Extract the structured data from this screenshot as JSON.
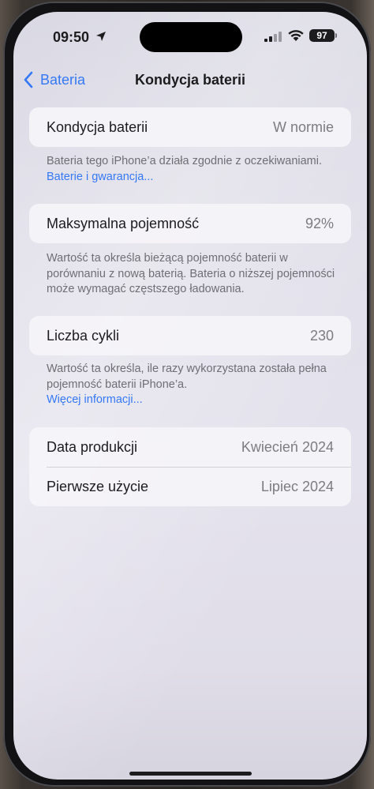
{
  "status_bar": {
    "time": "09:50",
    "battery_level": "97",
    "icons": [
      "location-arrow-icon",
      "cellular-signal-icon",
      "wifi-icon",
      "battery-icon"
    ]
  },
  "nav": {
    "back_label": "Bateria",
    "title": "Kondycja baterii"
  },
  "battery_health": {
    "label": "Kondycja baterii",
    "value": "W normie",
    "footnote_text": "Bateria tego iPhone’a działa zgodnie z oczekiwaniami.",
    "footnote_link": "Baterie i gwarancja..."
  },
  "max_capacity": {
    "label": "Maksymalna pojemność",
    "value": "92%",
    "footnote_text": "Wartość ta określa bieżącą pojemność baterii w porównaniu z nową baterią. Bateria o niższej pojemności może wymagać częstszego ładowania."
  },
  "cycle_count": {
    "label": "Liczba cykli",
    "value": "230",
    "footnote_text": "Wartość ta określa, ile razy wykorzystana została pełna pojemność baterii iPhone’a.",
    "footnote_link": "Więcej informacji..."
  },
  "dates": {
    "manufacture_label": "Data produkcji",
    "manufacture_value": "Kwiecień 2024",
    "first_use_label": "Pierwsze użycie",
    "first_use_value": "Lipiec 2024"
  },
  "colors": {
    "accent": "#3478f6",
    "label": "#1c1c1e",
    "secondary": "#7c7c82"
  }
}
